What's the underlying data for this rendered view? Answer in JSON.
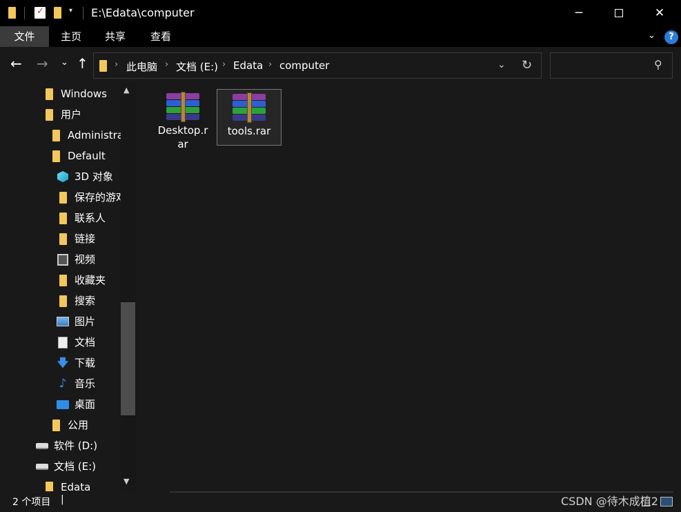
{
  "titlebar": {
    "path": "E:\\Edata\\computer",
    "minimize_icon": "minimize-icon",
    "maximize_icon": "maximize-icon",
    "close_icon": "close-icon"
  },
  "ribbon": {
    "tabs": [
      {
        "label": "文件",
        "active": true
      },
      {
        "label": "主页",
        "active": false
      },
      {
        "label": "共享",
        "active": false
      },
      {
        "label": "查看",
        "active": false
      }
    ],
    "help": "?"
  },
  "address": {
    "crumbs": [
      "此电脑",
      "文档 (E:)",
      "Edata",
      "computer"
    ],
    "search_placeholder": ""
  },
  "sidebar": {
    "items": [
      {
        "label": "Windows",
        "icon": "folder-icon"
      },
      {
        "label": "用户",
        "icon": "folder-icon"
      },
      {
        "label": "Administra",
        "icon": "folder-icon"
      },
      {
        "label": "Default",
        "icon": "folder-icon"
      },
      {
        "label": "3D 对象",
        "icon": "3d-objects-icon"
      },
      {
        "label": "保存的游戏",
        "icon": "saved-games-icon"
      },
      {
        "label": "联系人",
        "icon": "contacts-icon"
      },
      {
        "label": "链接",
        "icon": "links-icon"
      },
      {
        "label": "视频",
        "icon": "video-icon"
      },
      {
        "label": "收藏夹",
        "icon": "favorites-icon"
      },
      {
        "label": "搜索",
        "icon": "searches-icon"
      },
      {
        "label": "图片",
        "icon": "pictures-icon"
      },
      {
        "label": "文档",
        "icon": "documents-icon"
      },
      {
        "label": "下载",
        "icon": "downloads-icon"
      },
      {
        "label": "音乐",
        "icon": "music-icon"
      },
      {
        "label": "桌面",
        "icon": "desktop-icon"
      },
      {
        "label": "公用",
        "icon": "folder-icon"
      },
      {
        "label": "软件 (D:)",
        "icon": "drive-icon"
      },
      {
        "label": "文档 (E:)",
        "icon": "drive-icon"
      },
      {
        "label": "Edata",
        "icon": "folder-icon"
      }
    ]
  },
  "files": [
    {
      "name": "Desktop.rar",
      "label_line1": "Desktop.r",
      "label_line2": "ar",
      "selected": false
    },
    {
      "name": "tools.rar",
      "label_line1": "tools.rar",
      "label_line2": "",
      "selected": true
    }
  ],
  "status": {
    "item_count": "2 个项目",
    "caret": "|"
  },
  "watermark": "CSDN @待木成植2",
  "colors": {
    "folder": "#f2c75c",
    "accent_blue": "#2d7bd6",
    "background": "#191919",
    "titlebar": "#000000"
  }
}
